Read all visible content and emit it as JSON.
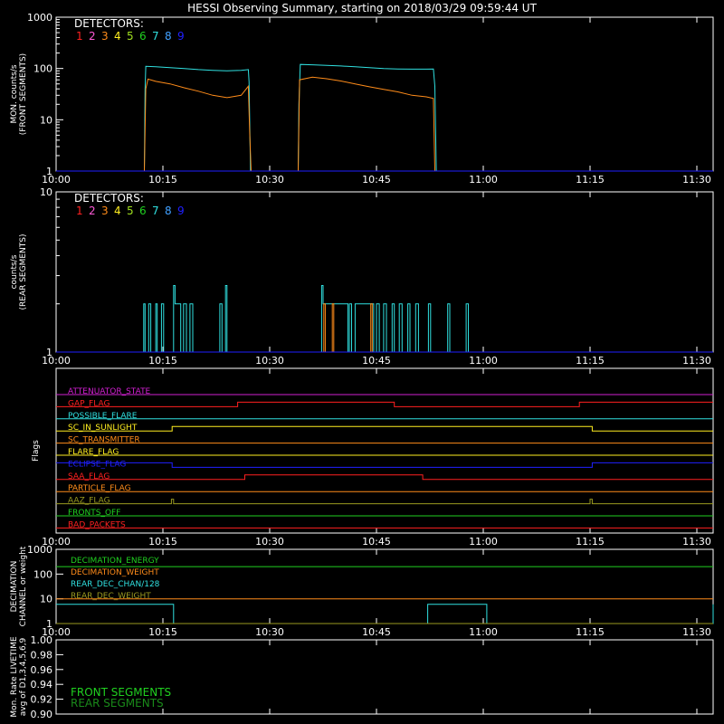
{
  "title": "HESSI Observing Summary, starting on 2018/03/29 09:59:44 UT",
  "colors": {
    "background": "#000000",
    "axes": "#ffffff",
    "det": [
      "#ff2020",
      "#ff5ad8",
      "#ff8c1a",
      "#ffee20",
      "#a0e020",
      "#20d020",
      "#30e0e0",
      "#40a0ff",
      "#2020ff"
    ]
  },
  "time_ticks": [
    "10:00",
    "10:15",
    "10:30",
    "10:45",
    "11:00",
    "11:15",
    "11:30"
  ],
  "detector_header": "DETECTORS:",
  "detector_numbers": [
    "1",
    "2",
    "3",
    "4",
    "5",
    "6",
    "7",
    "8",
    "9"
  ],
  "chart_data": [
    {
      "type": "line",
      "panel": "front",
      "ylabel": [
        "MON. counts/s",
        "(FRONT SEGMENTS)"
      ],
      "ylog": true,
      "ylim": [
        1,
        1000
      ],
      "y_ticks": [
        "1000",
        "100",
        "10",
        "1"
      ],
      "xlim_minutes": [
        0,
        46
      ],
      "series": [
        {
          "detector": "7",
          "color": "#30e0e0",
          "points": [
            [
              0,
              1
            ],
            [
              12.4,
              1
            ],
            [
              12.5,
              40
            ],
            [
              12.6,
              110
            ],
            [
              14,
              108
            ],
            [
              16,
              104
            ],
            [
              18,
              100
            ],
            [
              20,
              95
            ],
            [
              22,
              92
            ],
            [
              24,
              90
            ],
            [
              26,
              92
            ],
            [
              27,
              95
            ],
            [
              27.1,
              55
            ],
            [
              27.3,
              1
            ],
            [
              34,
              1
            ],
            [
              34.1,
              20
            ],
            [
              34.3,
              120
            ],
            [
              36,
              118
            ],
            [
              38,
              115
            ],
            [
              40,
              112
            ],
            [
              42,
              108
            ],
            [
              44,
              104
            ],
            [
              46,
              100
            ],
            [
              48,
              98
            ],
            [
              50,
              97
            ],
            [
              52,
              97
            ],
            [
              53,
              98
            ],
            [
              53.2,
              45
            ],
            [
              53.4,
              1
            ],
            [
              100,
              1
            ]
          ]
        },
        {
          "detector": "3",
          "color": "#ff8c1a",
          "points": [
            [
              0,
              1
            ],
            [
              12.4,
              1
            ],
            [
              12.6,
              40
            ],
            [
              12.9,
              62
            ],
            [
              14,
              56
            ],
            [
              16,
              50
            ],
            [
              18,
              42
            ],
            [
              20,
              36
            ],
            [
              22,
              30
            ],
            [
              24,
              27
            ],
            [
              26,
              30
            ],
            [
              27,
              45
            ],
            [
              27.2,
              5
            ],
            [
              27.4,
              1
            ],
            [
              34,
              1
            ],
            [
              34.2,
              60
            ],
            [
              36,
              68
            ],
            [
              38,
              63
            ],
            [
              40,
              57
            ],
            [
              42,
              50
            ],
            [
              44,
              44
            ],
            [
              46,
              39
            ],
            [
              48,
              35
            ],
            [
              50,
              30
            ],
            [
              52,
              28
            ],
            [
              53,
              26
            ],
            [
              53.2,
              1
            ],
            [
              100,
              1
            ]
          ]
        },
        {
          "detector": "9",
          "color": "#2020ff",
          "points": [
            [
              0,
              1
            ],
            [
              100,
              1
            ]
          ]
        }
      ]
    },
    {
      "type": "line",
      "panel": "rear",
      "ylabel": [
        "counts/s",
        "(REAR SEGMENTS)"
      ],
      "ylog": true,
      "ylim": [
        1,
        10
      ],
      "y_ticks": [
        "10",
        "1"
      ],
      "series": [
        {
          "detector": "7",
          "color": "#30e0e0",
          "points": [
            [
              0,
              1
            ],
            [
              12.3,
              1
            ],
            [
              12.3,
              2
            ],
            [
              12.5,
              2
            ],
            [
              12.5,
              1
            ],
            [
              13,
              1
            ],
            [
              13,
              2
            ],
            [
              13.3,
              2
            ],
            [
              13.3,
              1
            ],
            [
              14,
              1
            ],
            [
              14,
              2
            ],
            [
              14.2,
              2
            ],
            [
              14.2,
              1
            ],
            [
              14.8,
              1
            ],
            [
              14.8,
              2
            ],
            [
              15.1,
              2
            ],
            [
              15.1,
              1
            ],
            [
              16.5,
              1
            ],
            [
              16.5,
              2.6
            ],
            [
              16.7,
              2.6
            ],
            [
              16.7,
              2
            ],
            [
              17.5,
              2
            ],
            [
              17.5,
              1
            ],
            [
              17.9,
              1
            ],
            [
              17.9,
              2
            ],
            [
              18.3,
              2
            ],
            [
              18.3,
              1
            ],
            [
              18.8,
              1
            ],
            [
              18.8,
              2
            ],
            [
              19.2,
              2
            ],
            [
              19.2,
              1
            ],
            [
              23,
              1
            ],
            [
              23,
              2
            ],
            [
              23.3,
              2
            ],
            [
              23.3,
              1
            ],
            [
              23.8,
              1
            ],
            [
              23.8,
              2.6
            ],
            [
              24,
              2.6
            ],
            [
              24,
              1
            ],
            [
              37.3,
              1
            ],
            [
              37.3,
              2.6
            ],
            [
              37.5,
              2.6
            ],
            [
              37.5,
              2
            ],
            [
              41,
              2
            ],
            [
              41,
              1
            ],
            [
              41.2,
              1
            ],
            [
              41.2,
              2
            ],
            [
              41.5,
              2
            ],
            [
              41.5,
              1
            ],
            [
              42,
              1
            ],
            [
              42,
              2
            ],
            [
              44.6,
              2
            ],
            [
              44.6,
              1
            ],
            [
              45,
              1
            ],
            [
              45,
              2
            ],
            [
              45.4,
              2
            ],
            [
              45.4,
              1
            ],
            [
              46,
              1
            ],
            [
              46,
              2
            ],
            [
              46.4,
              2
            ],
            [
              46.4,
              1
            ],
            [
              47.2,
              1
            ],
            [
              47.2,
              2
            ],
            [
              47.5,
              2
            ],
            [
              47.5,
              1
            ],
            [
              48.2,
              1
            ],
            [
              48.2,
              2
            ],
            [
              48.6,
              2
            ],
            [
              48.6,
              1
            ],
            [
              49.4,
              1
            ],
            [
              49.4,
              2
            ],
            [
              49.7,
              2
            ],
            [
              49.7,
              1
            ],
            [
              50.5,
              1
            ],
            [
              50.5,
              2
            ],
            [
              50.9,
              2
            ],
            [
              50.9,
              1
            ],
            [
              52.3,
              1
            ],
            [
              52.3,
              2
            ],
            [
              52.6,
              2
            ],
            [
              52.6,
              1
            ],
            [
              55,
              1
            ],
            [
              55,
              2
            ],
            [
              55.3,
              2
            ],
            [
              55.3,
              1
            ],
            [
              57.6,
              1
            ],
            [
              57.6,
              2
            ],
            [
              57.9,
              2
            ],
            [
              57.9,
              1
            ],
            [
              100,
              1
            ]
          ]
        },
        {
          "detector": "3",
          "color": "#ff8c1a",
          "points": [
            [
              0,
              1
            ],
            [
              37.6,
              1
            ],
            [
              37.6,
              2
            ],
            [
              37.8,
              2
            ],
            [
              37.8,
              1
            ],
            [
              38.8,
              1
            ],
            [
              38.8,
              2
            ],
            [
              39,
              2
            ],
            [
              39,
              1
            ],
            [
              44.2,
              1
            ],
            [
              44.2,
              2
            ],
            [
              44.4,
              2
            ],
            [
              44.4,
              1
            ],
            [
              100,
              1
            ]
          ]
        },
        {
          "detector": "9",
          "color": "#2020ff",
          "points": [
            [
              0,
              1
            ],
            [
              100,
              1
            ]
          ]
        }
      ]
    },
    {
      "type": "line",
      "panel": "flags",
      "ylabel": [
        "Flags"
      ],
      "flags": [
        {
          "label": "ATTENUATOR_STATE",
          "color": "#d020d0",
          "transitions": []
        },
        {
          "label": "GAP_FLAG",
          "color": "#ff2020",
          "transitions": [
            [
              0,
              0
            ],
            [
              25.5,
              1
            ],
            [
              47.5,
              0
            ],
            [
              73.5,
              1
            ]
          ]
        },
        {
          "label": "POSSIBLE_FLARE",
          "color": "#30e0e0",
          "transitions": []
        },
        {
          "label": "SC_IN_SUNLIGHT",
          "color": "#ffee20",
          "transitions": [
            [
              0,
              0
            ],
            [
              16.3,
              1
            ],
            [
              75.3,
              0
            ]
          ]
        },
        {
          "label": "SC_TRANSMITTER",
          "color": "#ff8c1a",
          "transitions": []
        },
        {
          "label": "FLARE_FLAG",
          "color": "#ffee20",
          "transitions": []
        },
        {
          "label": "ECLIPSE_FLAG",
          "color": "#2020ff",
          "transitions": [
            [
              0,
              1
            ],
            [
              16.3,
              0
            ],
            [
              75.3,
              1
            ]
          ]
        },
        {
          "label": "SAA_FLAG",
          "color": "#ff2020",
          "transitions": [
            [
              0,
              0
            ],
            [
              26.5,
              1
            ],
            [
              51.5,
              0
            ]
          ]
        },
        {
          "label": "PARTICLE_FLAG",
          "color": "#ff8c1a",
          "transitions": []
        },
        {
          "label": "AAZ_FLAG",
          "color": "#9a9a20",
          "transitions": [
            [
              0,
              0
            ],
            [
              16.2,
              1
            ],
            [
              16.5,
              0
            ],
            [
              75.0,
              1
            ],
            [
              75.3,
              0
            ]
          ]
        },
        {
          "label": "FRONTS_OFF",
          "color": "#20d020",
          "transitions": []
        },
        {
          "label": "BAD_PACKETS",
          "color": "#ff2020",
          "transitions": []
        }
      ]
    },
    {
      "type": "line",
      "panel": "decimation",
      "ylabel": [
        "DECIMATION",
        "CHANNEL or weight"
      ],
      "ylog": true,
      "ylim": [
        1,
        1000
      ],
      "y_ticks": [
        "1000",
        "100",
        "10",
        "1"
      ],
      "series": [
        {
          "name": "DECIMATION_ENERGY",
          "color": "#20d020",
          "points": [
            [
              0,
              200
            ],
            [
              100,
              200
            ]
          ]
        },
        {
          "name": "DECIMATION_WEIGHT",
          "color": "#ff8c1a",
          "points": [
            [
              0,
              10
            ],
            [
              100,
              10
            ]
          ]
        },
        {
          "name": "REAR_DEC_CHAN/128",
          "color": "#30e0e0",
          "points": [
            [
              0,
              6
            ],
            [
              16.5,
              6
            ],
            [
              16.5,
              1
            ],
            [
              52.2,
              1
            ],
            [
              52.2,
              6
            ],
            [
              60.5,
              6
            ],
            [
              60.5,
              1
            ],
            [
              94.5,
              1
            ],
            [
              94.5,
              6
            ],
            [
              100,
              6
            ]
          ]
        },
        {
          "name": "REAR_DEC_WEIGHT",
          "color": "#9a9a20",
          "points": [
            [
              0,
              1
            ],
            [
              100,
              1
            ]
          ]
        }
      ]
    },
    {
      "type": "line",
      "panel": "livetime",
      "ylabel": [
        "Mon. Rate LIVETIME",
        "avg of D1,3,4,5,6,9"
      ],
      "ylim": [
        0.9,
        1.0
      ],
      "y_ticks": [
        "1.00",
        "0.98",
        "0.96",
        "0.94",
        "0.92",
        "0.90"
      ],
      "series": [
        {
          "name": "FRONT SEGMENTS",
          "color": "#20d020",
          "points": []
        },
        {
          "name": "REAR SEGMENTS",
          "color": "#1a8a1a",
          "points": []
        }
      ]
    }
  ]
}
